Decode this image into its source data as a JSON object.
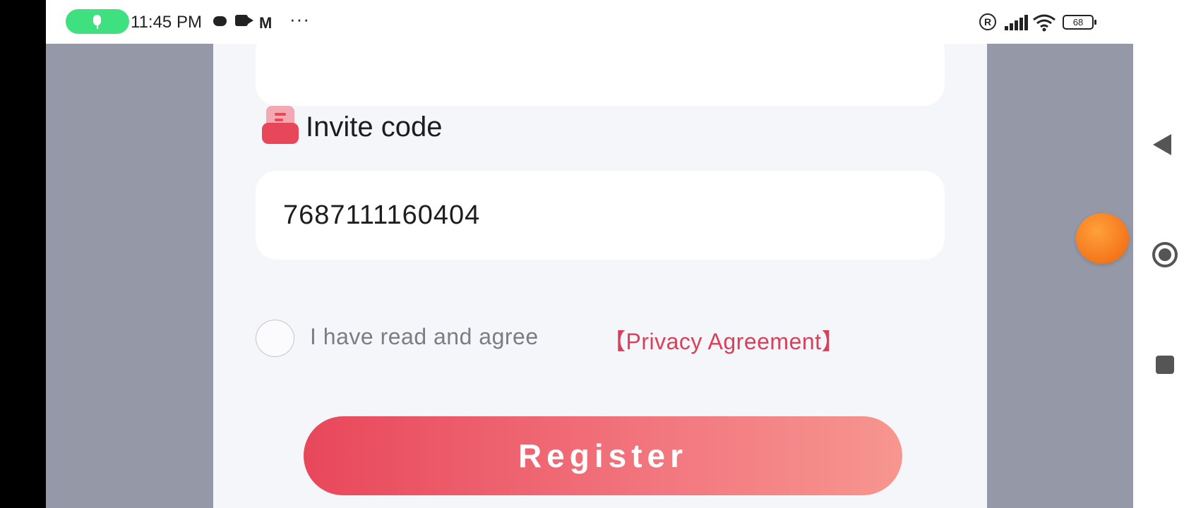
{
  "status_bar": {
    "time": "11:45 PM",
    "more": "···",
    "registered_mark": "R",
    "battery_level": "68",
    "icons": [
      "mic-icon",
      "chat-bubble-icon",
      "video-icon",
      "gmail-icon",
      "more-icon",
      "registered-icon",
      "signal-icon",
      "wifi-icon",
      "battery-icon"
    ]
  },
  "form": {
    "invite_label": "Invite code",
    "invite_value": "7687111160404",
    "agree_text": "I have read and agree",
    "privacy_link": "【Privacy Agreement】",
    "agree_checked": false,
    "register_label": "Register"
  },
  "navigation": {
    "icons": [
      "back-icon",
      "home-icon",
      "recents-icon"
    ]
  },
  "colors": {
    "accent": "#e8475a",
    "link": "#d9415a",
    "page_background": "#f5f6fa",
    "dim_overlay": "#9598a6",
    "floating_ball": "#f77c1f"
  }
}
